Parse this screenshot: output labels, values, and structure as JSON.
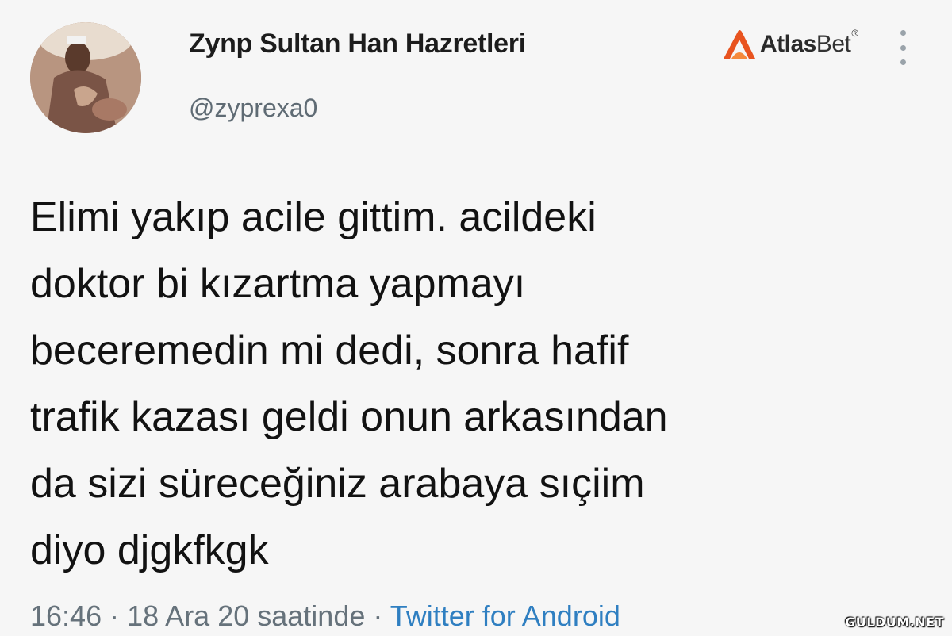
{
  "author": {
    "display_name": "Zynp Sultan Han Hazretleri",
    "handle": "@zyprexa0",
    "avatar_icon": "profile-photo"
  },
  "brand": {
    "name_bold": "Atlas",
    "name_light": "Bet",
    "registered": "®",
    "icon": "atlasbet-logo-icon",
    "color": "#e8531f"
  },
  "menu": {
    "icon": "more-vertical-icon"
  },
  "tweet": {
    "lines": [
      "Elimi yakıp acile gittim. acildeki",
      "doktor bi kızartma yapmayı",
      "beceremedin mi dedi, sonra hafif",
      "trafik kazası geldi onun arkasından",
      "da sizi süreceğiniz arabaya sıçiim",
      "diyo djgkfkgk"
    ]
  },
  "meta": {
    "time": "16:46",
    "separator": "·",
    "date": "18 Ara 20 saatinde",
    "source": "Twitter for Android"
  },
  "watermark": "GULDUM.NET"
}
